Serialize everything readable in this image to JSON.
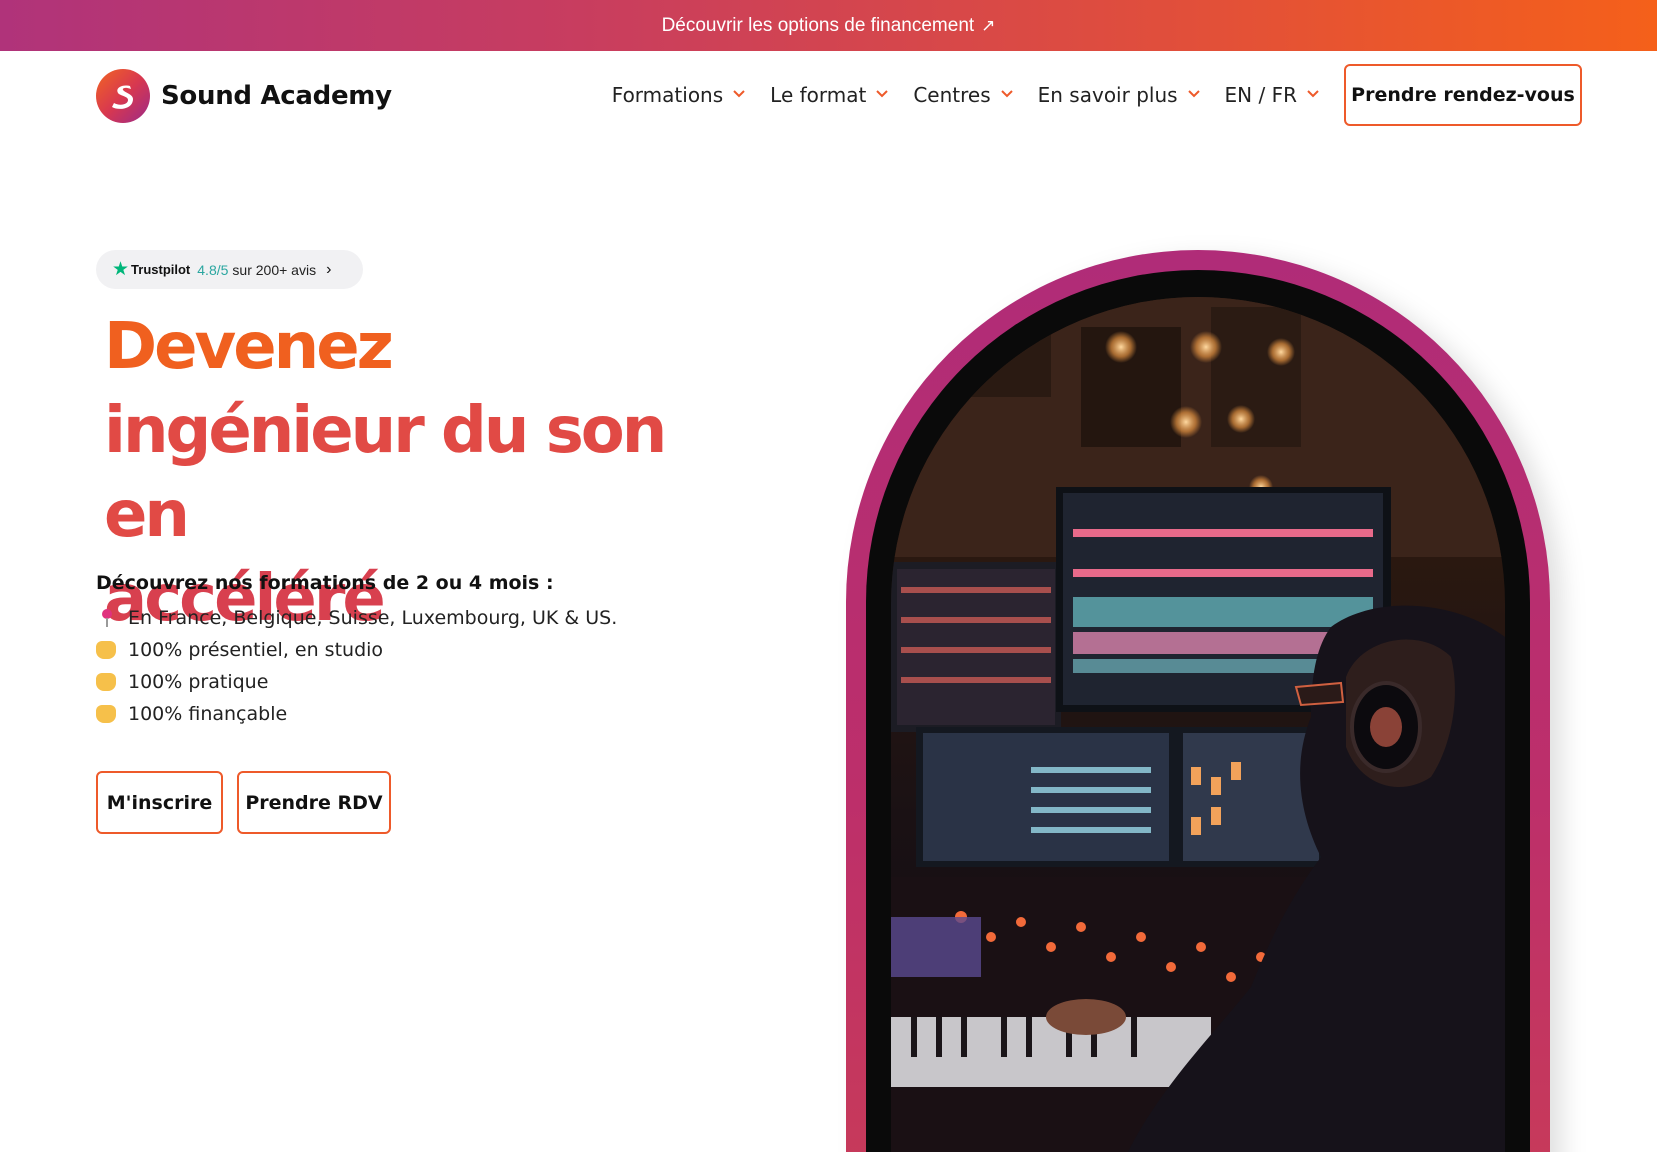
{
  "topbar": {
    "text": "Découvrir les options de financement",
    "arrow": "↗"
  },
  "brand": {
    "name": "Sound Academy"
  },
  "nav": {
    "items": [
      {
        "label": "Formations"
      },
      {
        "label": "Le format"
      },
      {
        "label": "Centres"
      },
      {
        "label": "En savoir plus"
      },
      {
        "label": "EN / FR"
      }
    ],
    "cta": "Prendre rendez-vous"
  },
  "trustpilot": {
    "brand": "Trustpilot",
    "score": "4.8/5",
    "reviews": "sur 200+ avis"
  },
  "hero": {
    "title_lines": [
      "Devenez",
      "ingénieur du son en",
      "accéléré"
    ],
    "intro": "Découvrez nos formations de 2 ou 4 mois :",
    "bullets": [
      {
        "icon": "pin-icon",
        "text": "En France, Belgique, Suisse, Luxembourg, UK & US."
      },
      {
        "icon": "waving-hand-icon",
        "text": "100% présentiel, en studio"
      },
      {
        "icon": "pointing-hand-icon",
        "text": "100% pratique"
      },
      {
        "icon": "ok-hand-icon",
        "text": "100% finançable"
      }
    ],
    "buttons": {
      "primary": "M'inscrire",
      "secondary": "Prendre RDV"
    }
  },
  "colors": {
    "accent_orange": "#f0601f",
    "accent_magenta": "#b02c78",
    "trustpilot_green": "#00b67a"
  }
}
